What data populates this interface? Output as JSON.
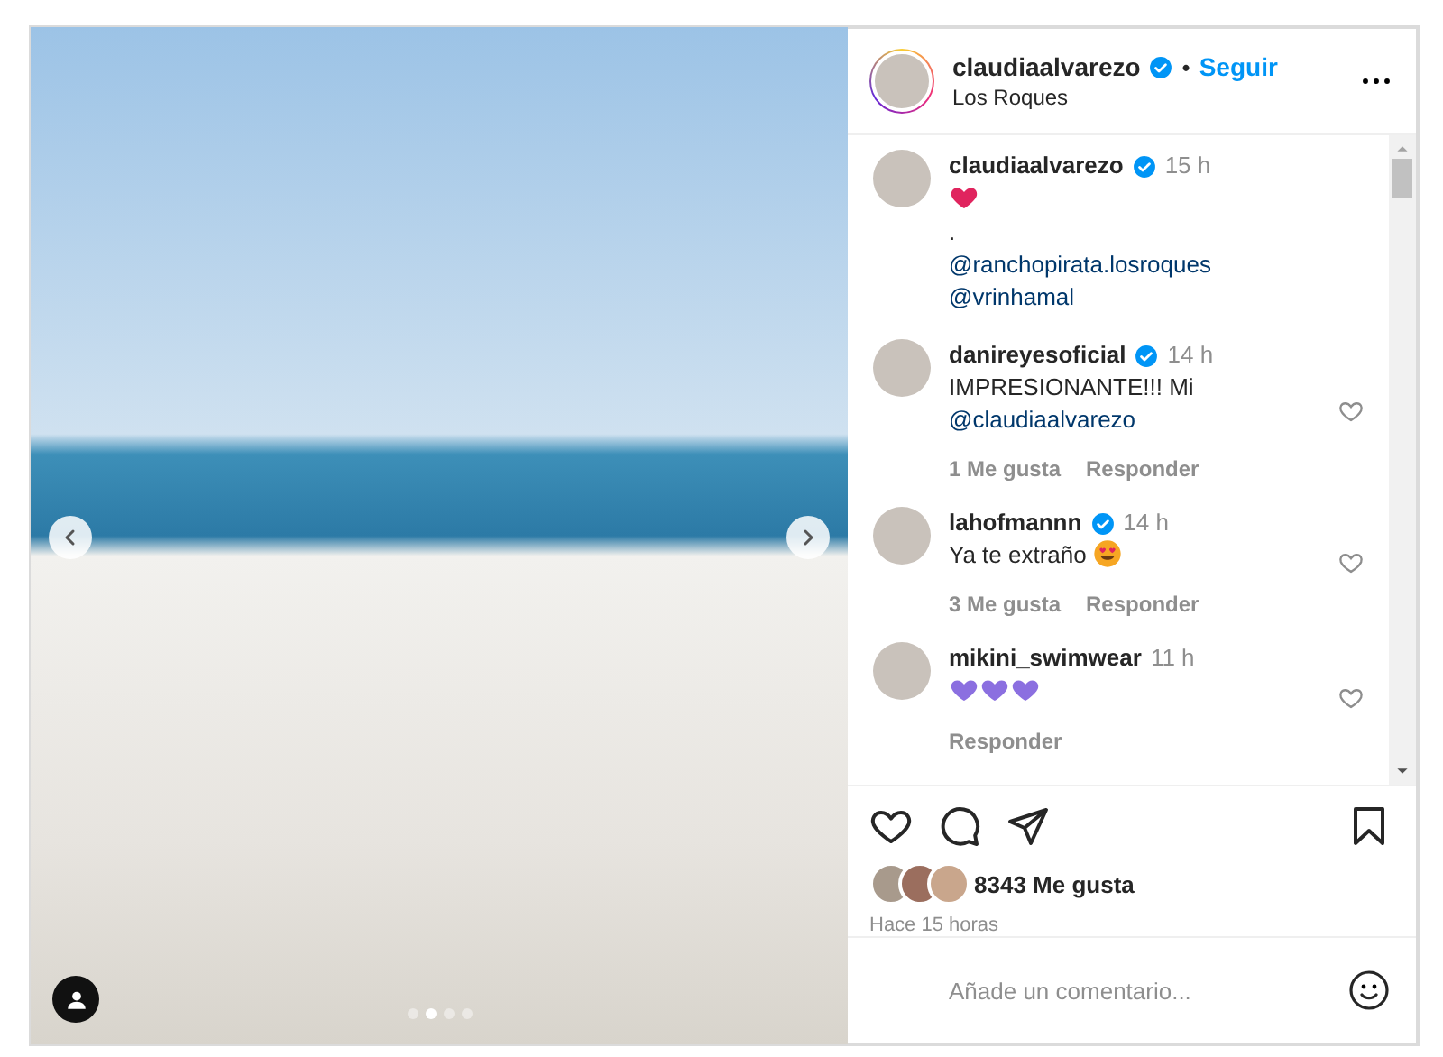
{
  "media": {
    "dots": [
      {
        "selected": false
      },
      {
        "selected": true
      },
      {
        "selected": false
      },
      {
        "selected": false
      }
    ]
  },
  "header": {
    "username": "claudiaalvarezo",
    "verified": true,
    "separator": "•",
    "follow": "Seguir",
    "location": "Los Roques"
  },
  "comments": [
    {
      "username": "claudiaalvarezo",
      "verified": true,
      "time": "15 h",
      "lines": [
        [
          {
            "kind": "heart",
            "color": "#e0245e"
          }
        ],
        [
          {
            "kind": "text",
            "text": "."
          }
        ],
        [
          {
            "kind": "mention",
            "text": "@ranchopirata.losroques"
          }
        ],
        [
          {
            "kind": "mention",
            "text": "@vrinhamal"
          }
        ]
      ],
      "like_button": false
    },
    {
      "username": "danireyesoficial",
      "verified": true,
      "time": "14 h",
      "lines": [
        [
          {
            "kind": "text",
            "text": "IMPRESIONANTE!!! Mi"
          }
        ],
        [
          {
            "kind": "mention",
            "text": "@claudiaalvarezo"
          }
        ]
      ],
      "likes": "1 Me gusta",
      "reply": "Responder",
      "like_button": true
    },
    {
      "username": "lahofmannn",
      "verified": true,
      "time": "14 h",
      "lines": [
        [
          {
            "kind": "text",
            "text": "Ya te extraño"
          },
          {
            "kind": "heart-eyes"
          }
        ]
      ],
      "likes": "3 Me gusta",
      "reply": "Responder",
      "like_button": true
    },
    {
      "username": "mikini_swimwear",
      "verified": false,
      "time": "11 h",
      "lines": [
        [
          {
            "kind": "heart",
            "color": "#8b6fe0"
          },
          {
            "kind": "heart",
            "color": "#8b6fe0"
          },
          {
            "kind": "heart",
            "color": "#8b6fe0"
          }
        ]
      ],
      "reply": "Responder",
      "like_button": true
    }
  ],
  "likes": "8343 Me gusta",
  "posted": "Hace 15 horas",
  "comment_input": {
    "placeholder": "Añade un comentario..."
  }
}
